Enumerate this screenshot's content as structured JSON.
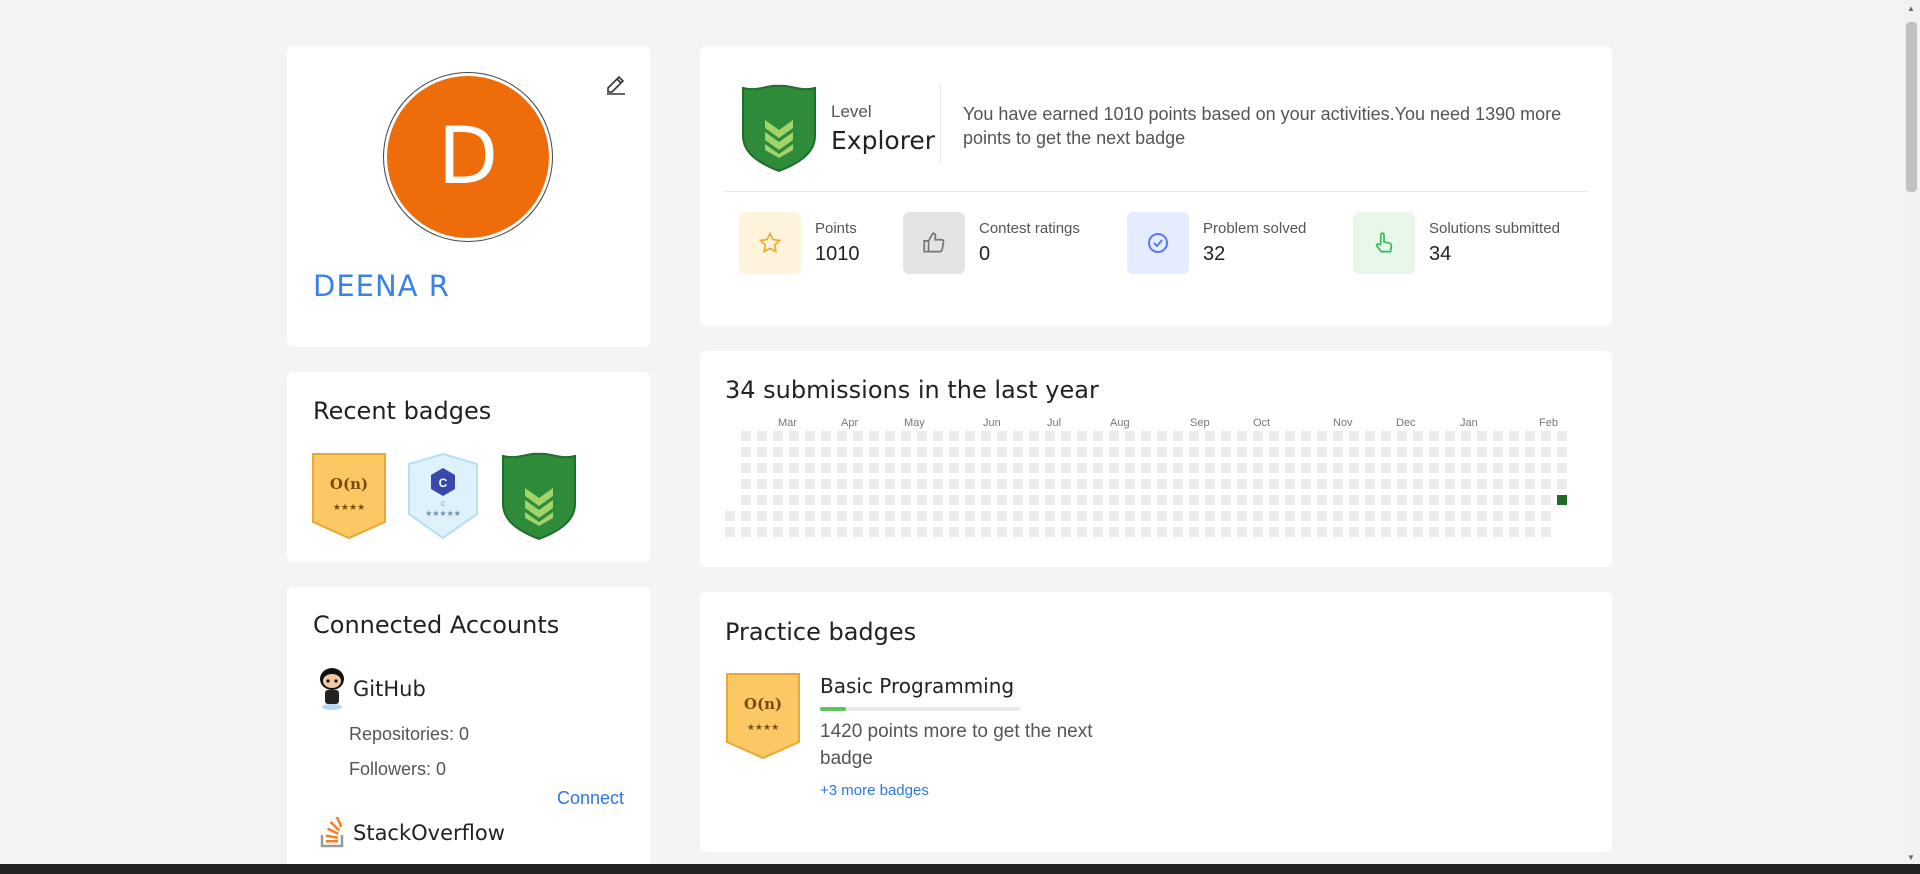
{
  "profile": {
    "avatar_letter": "D",
    "name": "DEENA R",
    "avatar_color": "#ee6c0a"
  },
  "recent_badges": {
    "title": "Recent badges",
    "items": [
      {
        "icon": "complexity-badge-icon",
        "text": "O(n)",
        "stars": "★★★★"
      },
      {
        "icon": "c-language-badge-icon",
        "text": "C",
        "sub": "C",
        "stars": "★★★★★"
      },
      {
        "icon": "explorer-shield-badge-icon"
      }
    ]
  },
  "accounts": {
    "title": "Connected Accounts",
    "github": {
      "name": "GitHub",
      "repositories": "Repositories: 0",
      "followers": "Followers: 0",
      "connect": "Connect"
    },
    "stackoverflow": {
      "name": "StackOverflow"
    }
  },
  "level": {
    "label": "Level",
    "value": "Explorer",
    "description": "You have earned 1010 points based on your activities.You need 1390 more points to get the next badge"
  },
  "stats": [
    {
      "label": "Points",
      "value": "1010",
      "icon": "star-icon",
      "bg": "#fff3dc",
      "color": "#f5a623"
    },
    {
      "label": "Contest ratings",
      "value": "0",
      "icon": "thumbs-up-icon",
      "bg": "#e4e4e4",
      "color": "#777"
    },
    {
      "label": "Problem solved",
      "value": "32",
      "icon": "check-circle-icon",
      "bg": "#e6ecff",
      "color": "#5b7bea"
    },
    {
      "label": "Solutions submitted",
      "value": "34",
      "icon": "pointer-hand-icon",
      "bg": "#e7f7ea",
      "color": "#3fb85a"
    }
  ],
  "heatmap": {
    "title": "34 submissions in the last year",
    "months": [
      "Mar",
      "Apr",
      "May",
      "Jun",
      "Jul",
      "Aug",
      "Sep",
      "Oct",
      "Nov",
      "Dec",
      "Jan",
      "Feb"
    ],
    "weeks": 53,
    "active_cell": {
      "week": 52,
      "day": 4
    },
    "empty_color": "#ebebeb",
    "active_color": "#1e6b2a"
  },
  "practice": {
    "title": "Practice badges",
    "badge_text": "O(n)",
    "badge_stars": "★★★★",
    "name": "Basic Programming",
    "progress": 0.13,
    "desc": "1420 points more to get the next badge",
    "more": "+3 more badges"
  }
}
